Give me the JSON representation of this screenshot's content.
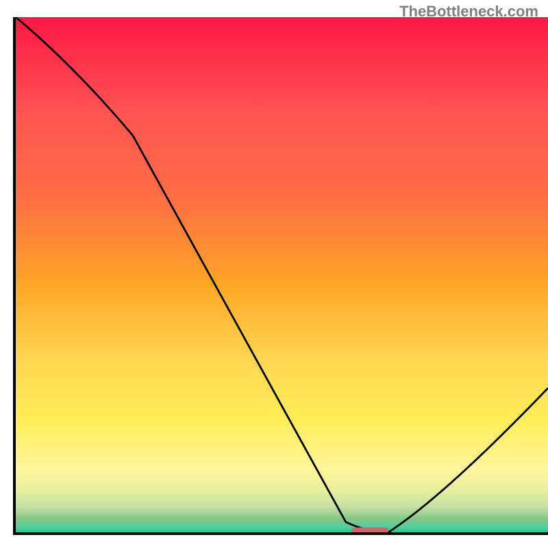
{
  "watermark": "TheBottleneck.com",
  "colors": {
    "axis": "#000000",
    "curve": "#000000",
    "marker": "#C9676C",
    "gradient_top": "#FF1744",
    "gradient_mid": "#FFD54F",
    "gradient_bottom": "#26C68A"
  },
  "chart_data": {
    "type": "line",
    "title": "",
    "xlabel": "",
    "ylabel": "",
    "xlim": [
      0,
      100
    ],
    "ylim": [
      0,
      100
    ],
    "x": [
      0,
      22,
      62,
      70,
      100
    ],
    "values": [
      100,
      77,
      2,
      0,
      28
    ],
    "marker": {
      "x_start": 63,
      "x_end": 70,
      "y": 0.3,
      "height": 1.2
    }
  }
}
